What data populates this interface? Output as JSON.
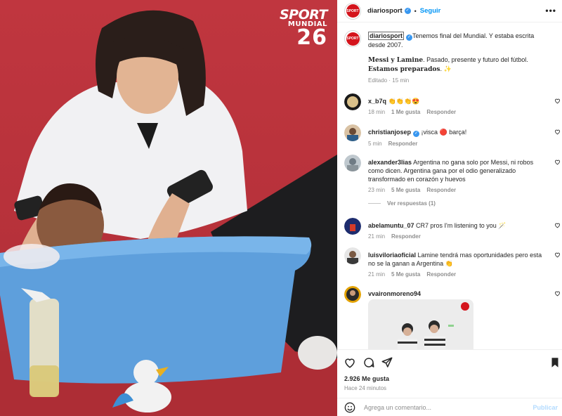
{
  "brand": {
    "line1": "SPORT",
    "line2": "MUNDIAL",
    "line3": "26"
  },
  "header": {
    "username": "diariosport",
    "separator": "•",
    "follow_label": "Seguir",
    "more_label": "•••",
    "avatar_text": "SPORT"
  },
  "caption": {
    "username": "diariosport",
    "text": "Tenemos final del Mundial. Y estaba escrita desde 2007.",
    "line2_bold": "Messi y Lamine",
    "line2_text": ". Pasado, presente y futuro del fútbol. ",
    "line2_bold2": "Estamos preparados",
    "line2_end": ". ✨",
    "meta": "Editado · 15 min"
  },
  "comments": [
    {
      "username": "x_b7q",
      "text": "👏👏👏😍",
      "time": "18 min",
      "likes": "1 Me gusta",
      "reply": "Responder"
    },
    {
      "username": "christianjosep",
      "verified": true,
      "text": "¡visca 🔴 barça!",
      "time": "5 min",
      "likes": "",
      "reply": "Responder"
    },
    {
      "username": "alexander3lias",
      "text": "Argentina no gana solo por Messi, ni robos como dicen. Argentina gana por el odio generalizado transformado en corazón y huevos",
      "time": "23 min",
      "likes": "5 Me gusta",
      "reply": "Responder"
    },
    {
      "username": "abelamuntu_07",
      "text": "CR7 pros I'm listening to you 🪄",
      "time": "21 min",
      "likes": "",
      "reply": "Responder"
    },
    {
      "username": "luisviloriaoficial",
      "text": "Lamine tendrá mas oportunidades pero esta no se la ganan a Argentina 👏",
      "time": "21 min",
      "likes": "5 Me gusta",
      "reply": "Responder"
    },
    {
      "username": "vvaironmoreno94",
      "text": "",
      "time": "",
      "likes": "",
      "reply": ""
    }
  ],
  "view_replies": "Ver respuestas (1)",
  "actions": {
    "likes": "2.926 Me gusta",
    "ago": "Hace 24 minutos"
  },
  "add_comment": {
    "placeholder": "Agrega un comentario...",
    "post_label": "Publicar"
  },
  "colors": {
    "accent": "#0095f6",
    "verified": "#3897f0",
    "background_red": "#b6313a"
  }
}
